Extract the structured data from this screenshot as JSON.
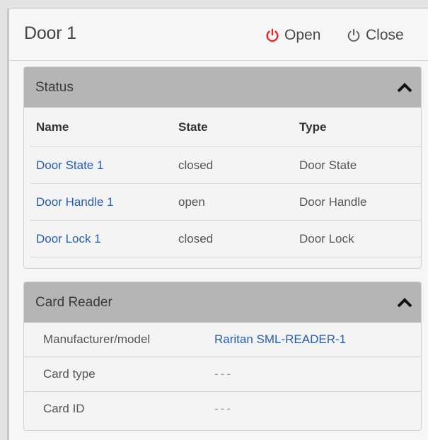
{
  "header": {
    "title": "Door 1",
    "open_label": "Open",
    "close_label": "Close",
    "open_icon_color": "#e8262a"
  },
  "status_panel": {
    "title": "Status",
    "columns": [
      "Name",
      "State",
      "Type"
    ],
    "rows": [
      {
        "name": "Door State 1",
        "state": "closed",
        "type": "Door State"
      },
      {
        "name": "Door Handle 1",
        "state": "open",
        "type": "Door Handle"
      },
      {
        "name": "Door Lock 1",
        "state": "closed",
        "type": "Door Lock"
      }
    ]
  },
  "card_reader_panel": {
    "title": "Card Reader",
    "rows": [
      {
        "label": "Manufacturer/model",
        "value": "Raritan SML-READER-1"
      },
      {
        "label": "Card type",
        "value": "---"
      },
      {
        "label": "Card ID",
        "value": "---"
      }
    ]
  },
  "colors": {
    "link": "#2a5db0",
    "panel_header": "#b5b5b5"
  }
}
